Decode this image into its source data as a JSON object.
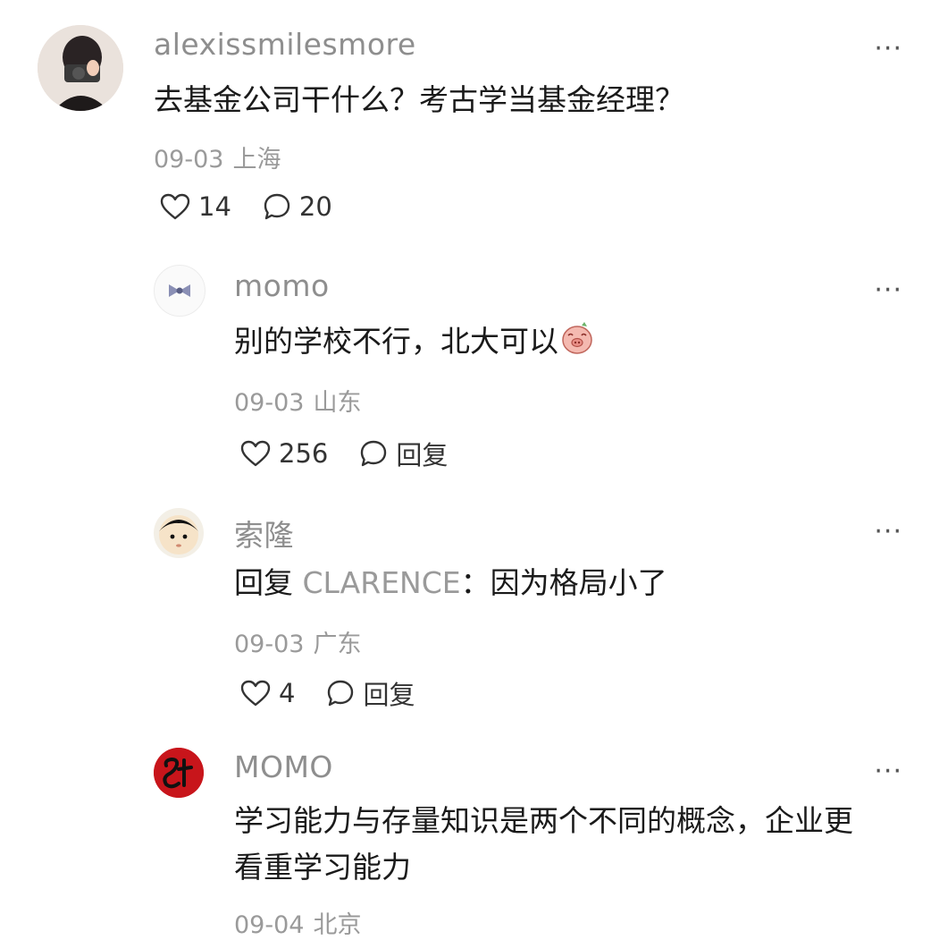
{
  "comments": [
    {
      "username": "alexissmilesmore",
      "text": "去基金公司干什么？考古学当基金经理？",
      "date": "09-03",
      "location": "上海",
      "likes": "14",
      "reply_label": "20"
    },
    {
      "username": "momo",
      "text": "别的学校不行，北大可以",
      "date": "09-03",
      "location": "山东",
      "likes": "256",
      "reply_label": "回复"
    },
    {
      "username": "索隆",
      "text_prefix": "回复",
      "mention": "CLARENCE",
      "text": "：因为格局小了",
      "date": "09-03",
      "location": "广东",
      "likes": "4",
      "reply_label": "回复"
    },
    {
      "username": "MOMO",
      "text_line1": "学习能力与存量知识是两个不同的概念，企业更",
      "text_line2": "看重学习能力",
      "date": "09-04",
      "location": "北京"
    }
  ],
  "more_label": "···",
  "colors": {
    "username": "#8e8e8e",
    "meta": "#9a9a9a",
    "text": "#1a1a1a"
  },
  "icons": [
    "heart-icon",
    "comment-bubble-icon",
    "more-icon",
    "pig-emoji"
  ]
}
